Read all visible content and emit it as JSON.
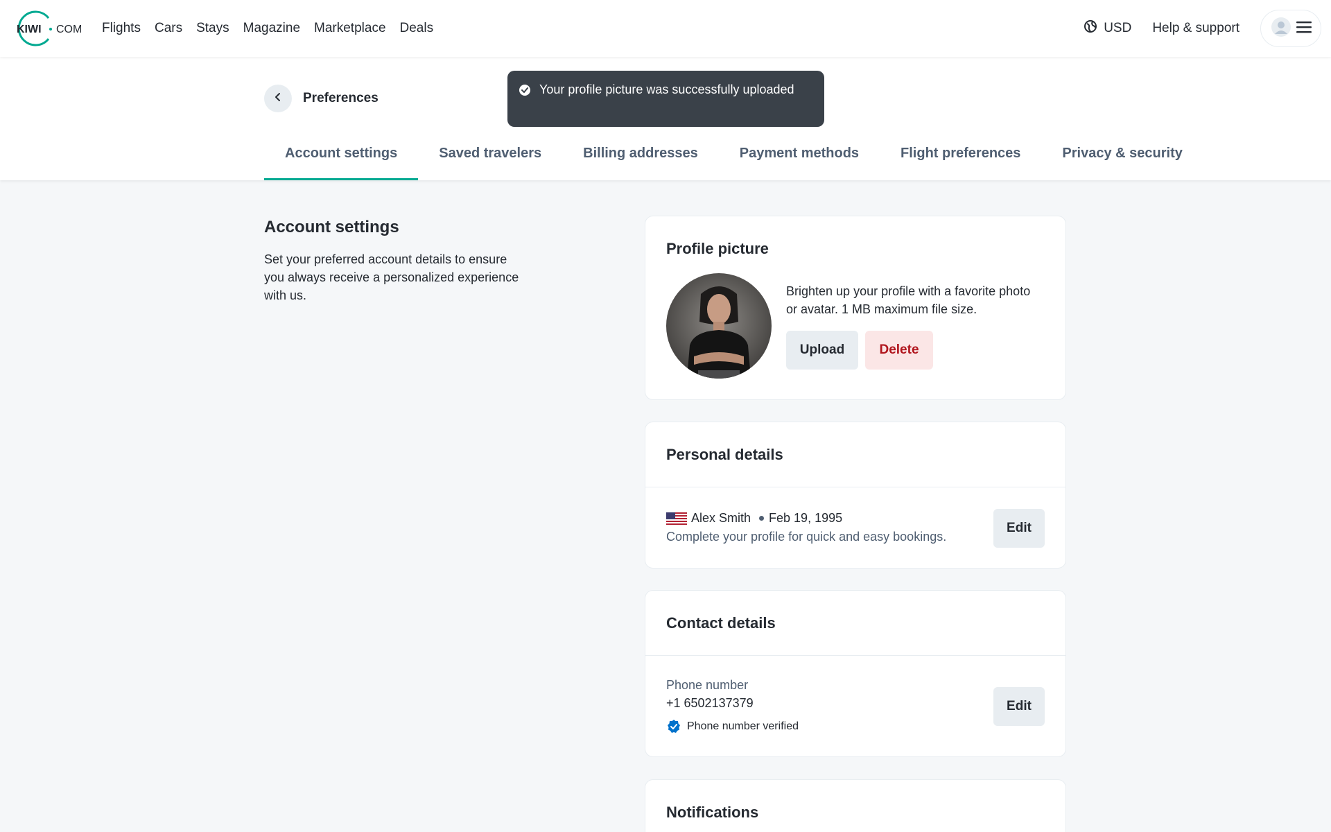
{
  "brand": {
    "logo_main": "KIWI",
    "logo_suffix": "COM"
  },
  "nav": {
    "items": [
      "Flights",
      "Cars",
      "Stays",
      "Magazine",
      "Marketplace",
      "Deals"
    ]
  },
  "header_right": {
    "currency": "USD",
    "help": "Help & support"
  },
  "page": {
    "back_label": "Preferences"
  },
  "tabs": [
    {
      "label": "Account settings",
      "active": true
    },
    {
      "label": "Saved travelers"
    },
    {
      "label": "Billing addresses"
    },
    {
      "label": "Payment methods"
    },
    {
      "label": "Flight preferences"
    },
    {
      "label": "Privacy & security"
    }
  ],
  "toast": {
    "message": "Your profile picture was successfully uploaded"
  },
  "sidebar": {
    "title": "Account settings",
    "description": "Set your preferred account details to ensure you always receive a personalized experience with us."
  },
  "profile_picture": {
    "title": "Profile picture",
    "description": "Brighten up your profile with a favorite photo or avatar. 1 MB maximum file size.",
    "upload_label": "Upload",
    "delete_label": "Delete"
  },
  "personal_details": {
    "title": "Personal details",
    "name": "Alex Smith",
    "dob": "Feb 19, 1995",
    "hint": "Complete your profile for quick and easy bookings.",
    "edit_label": "Edit"
  },
  "contact_details": {
    "title": "Contact details",
    "phone_label": "Phone number",
    "phone_value": "+1 6502137379",
    "verified_text": "Phone number verified",
    "edit_label": "Edit"
  },
  "notifications": {
    "title": "Notifications"
  },
  "colors": {
    "accent": "#00a991",
    "verified": "#0172cb",
    "danger": "#b0141c"
  }
}
